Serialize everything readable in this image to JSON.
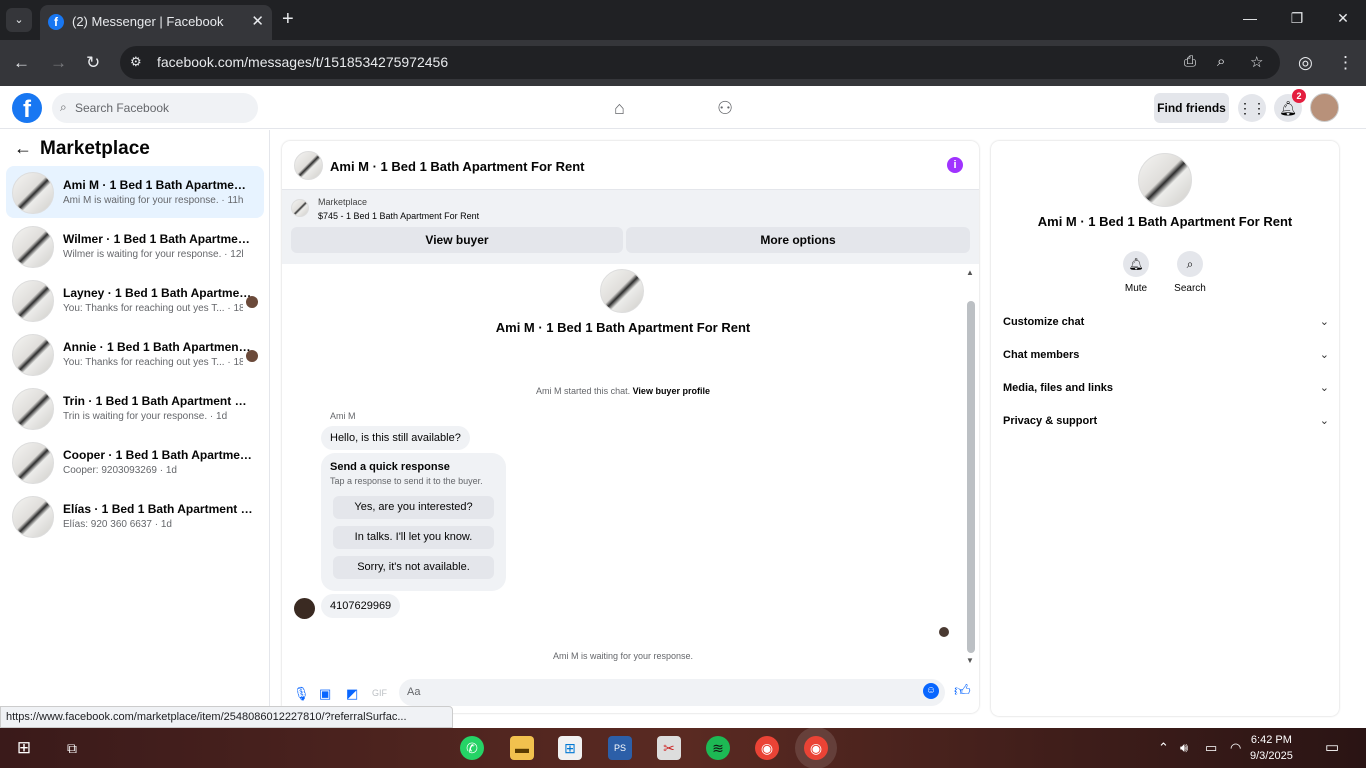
{
  "browser": {
    "tab_title": "(2) Messenger | Facebook",
    "url": "facebook.com/messages/t/1518534275972456",
    "status_url": "https://www.facebook.com/marketplace/item/2548086012227810/?referralSurfac..."
  },
  "fb": {
    "search_placeholder": "Search Facebook",
    "find_friends": "Find friends",
    "notif_count": "2"
  },
  "sidebar": {
    "title": "Marketplace",
    "conversations": [
      {
        "name": "Ami M · 1 Bed 1 Bath Apartment F...",
        "preview": "Ami M is waiting for your response. · 11h"
      },
      {
        "name": "Wilmer · 1 Bed 1 Bath Apartment F...",
        "preview": "Wilmer is waiting for your response. · 12h"
      },
      {
        "name": "Layney · 1 Bed 1 Bath Apartment...",
        "preview": "You: Thanks for reaching out yes T... · 18h"
      },
      {
        "name": "Annie · 1 Bed 1 Bath Apartment ...",
        "preview": "You: Thanks for reaching out yes T... · 18h"
      },
      {
        "name": "Trin · 1 Bed 1 Bath Apartment For R...",
        "preview": "Trin is waiting for your response. · 1d"
      },
      {
        "name": "Cooper · 1 Bed 1 Bath Apartment F...",
        "preview": "Cooper: 9203093269 · 1d"
      },
      {
        "name": "Elías · 1 Bed 1 Bath Apartment For ...",
        "preview": "Elías: 920 360 6637 · 1d"
      }
    ]
  },
  "chat": {
    "title": "Ami M · 1 Bed 1 Bath Apartment For Rent",
    "marketplace_label": "Marketplace",
    "listing": "$745 - 1 Bed 1 Bath Apartment For Rent",
    "view_buyer": "View buyer",
    "more_options": "More options",
    "started": "Ami M started this chat.",
    "view_profile": "View buyer profile",
    "sender": "Ami M",
    "msg1": "Hello, is this still available?",
    "quick_title": "Send a quick response",
    "quick_sub": "Tap a response to send it to the buyer.",
    "quick_responses": [
      "Yes, are you interested?",
      "In talks. I'll let you know.",
      "Sorry, it's not available."
    ],
    "msg2": "4107629969",
    "waiting": "Ami M is waiting for your response.",
    "composer_placeholder": "Aa"
  },
  "info": {
    "title": "Ami M · 1 Bed 1 Bath Apartment For Rent",
    "mute": "Mute",
    "search": "Search",
    "sections": [
      "Customize chat",
      "Chat members",
      "Media, files and links",
      "Privacy & support"
    ]
  },
  "taskbar": {
    "time": "6:42 PM",
    "date": "9/3/2025"
  },
  "colors": {
    "fb_blue": "#1877f2",
    "messenger_blue": "#0866ff",
    "info_purple": "#a033ff"
  }
}
